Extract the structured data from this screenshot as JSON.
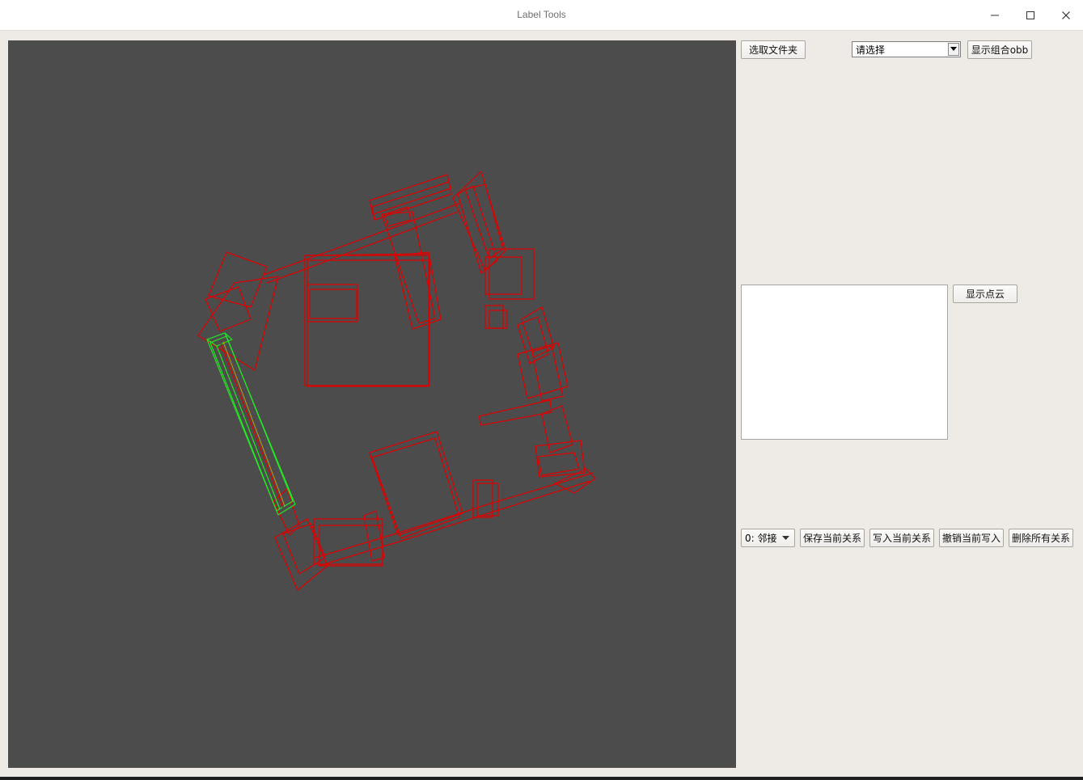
{
  "window": {
    "title": "Label Tools"
  },
  "toolbar": {
    "select_folder_label": "选取文件夹",
    "object_select": {
      "selected": "请选择"
    },
    "show_combined_obb_label": "显示组合obb"
  },
  "pointcloud": {
    "show_pointcloud_label": "显示点云"
  },
  "relations": {
    "relation_select": {
      "selected": "0: 邻接"
    },
    "save_label": "保存当前关系",
    "write_label": "写入当前关系",
    "undo_write_label": "撤销当前写入",
    "delete_all_label": "删除所有关系"
  },
  "colors": {
    "viewport_bg": "#4c4c4c",
    "box_default": "#e00000",
    "box_selected": "#22ee22",
    "window_bg": "#eeebe6"
  }
}
